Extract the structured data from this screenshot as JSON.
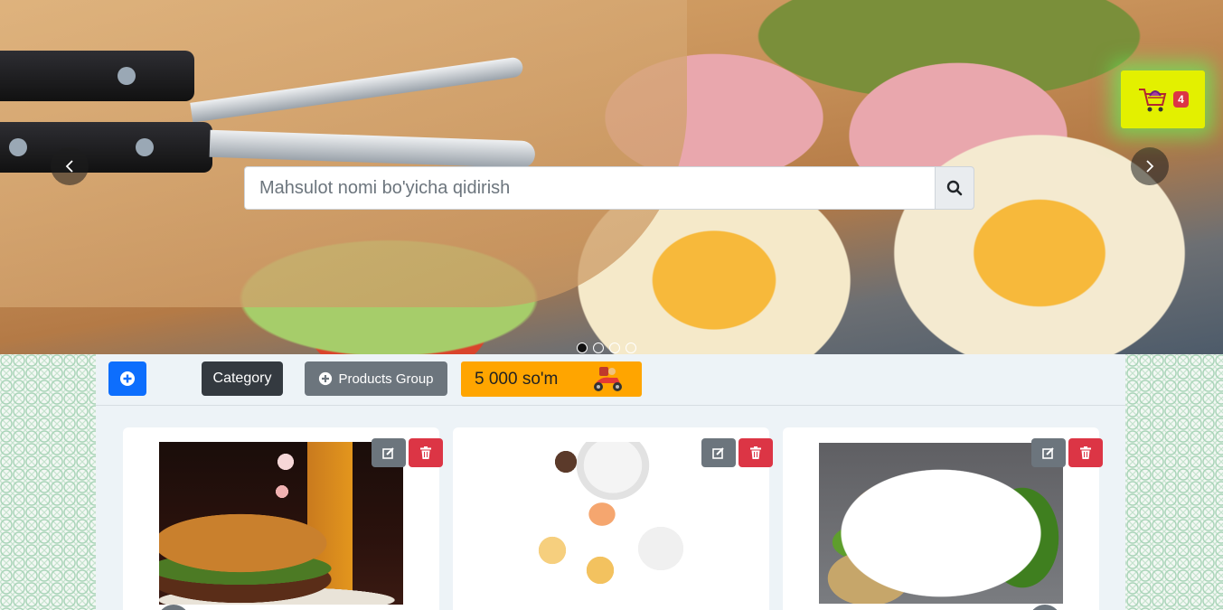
{
  "hero": {
    "search": {
      "placeholder": "Mahsulot nomi bo'yicha qidirish"
    },
    "prev_icon": "chevron-left-icon",
    "next_icon": "chevron-right-icon",
    "slides_count": 4,
    "active_slide": 1
  },
  "cart": {
    "count": "4",
    "icon": "shopping-cart-icon"
  },
  "toolbar": {
    "add_icon": "plus-circle-icon",
    "category_label": "Category",
    "products_group_label": "Products Group",
    "delivery_price": "5 000 so'm",
    "delivery_icon": "delivery-scooter-icon"
  },
  "products": [
    {
      "image": "burger-and-beer-photo",
      "edit_icon": "edit-icon",
      "delete_icon": "trash-icon"
    },
    {
      "image": "breakfast-flatlay-photo",
      "edit_icon": "edit-icon",
      "delete_icon": "trash-icon"
    },
    {
      "image": "grilled-meat-photo",
      "edit_icon": "edit-icon",
      "delete_icon": "trash-icon"
    }
  ],
  "colors": {
    "primary": "#0d6efd",
    "dark": "#343a40",
    "secondary": "#6c757d",
    "danger": "#dc3545",
    "delivery": "#ffa500",
    "cart_highlight": "#e3f000"
  }
}
